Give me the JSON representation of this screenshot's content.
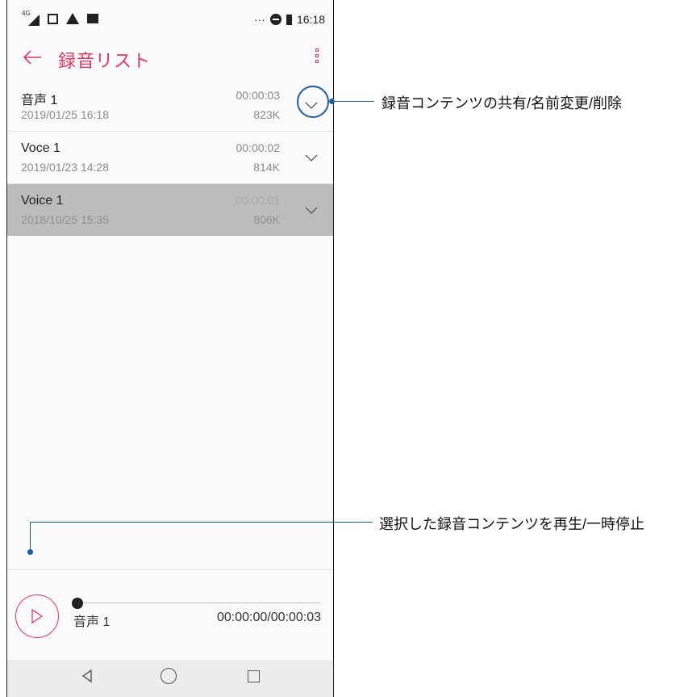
{
  "status_bar": {
    "network": "4G",
    "time": "16:18",
    "more": "···"
  },
  "app_bar": {
    "title": "録音リスト"
  },
  "recordings": [
    {
      "name": "音声 1",
      "date": "2019/01/25 16:18",
      "duration": "00:00:03",
      "size": "823K"
    },
    {
      "name": "Voce 1",
      "date": "2019/01/23 14:28",
      "duration": "00:00:02",
      "size": "814K"
    },
    {
      "name": "Voice 1",
      "date": "2018/10/25 15:35",
      "duration": "00:00:01",
      "size": "806K"
    }
  ],
  "player": {
    "name": "音声 1",
    "time": "00:00:00/00:00:03",
    "progress": 0
  },
  "callouts": {
    "expand": "録音コンテンツの共有/名前変更/削除",
    "play": "選択した録音コンテンツを再生/一時停止"
  },
  "colors": {
    "accent": "#e6345f",
    "callout": "#1f5e9c",
    "selected_row": "#bcbcbc"
  }
}
